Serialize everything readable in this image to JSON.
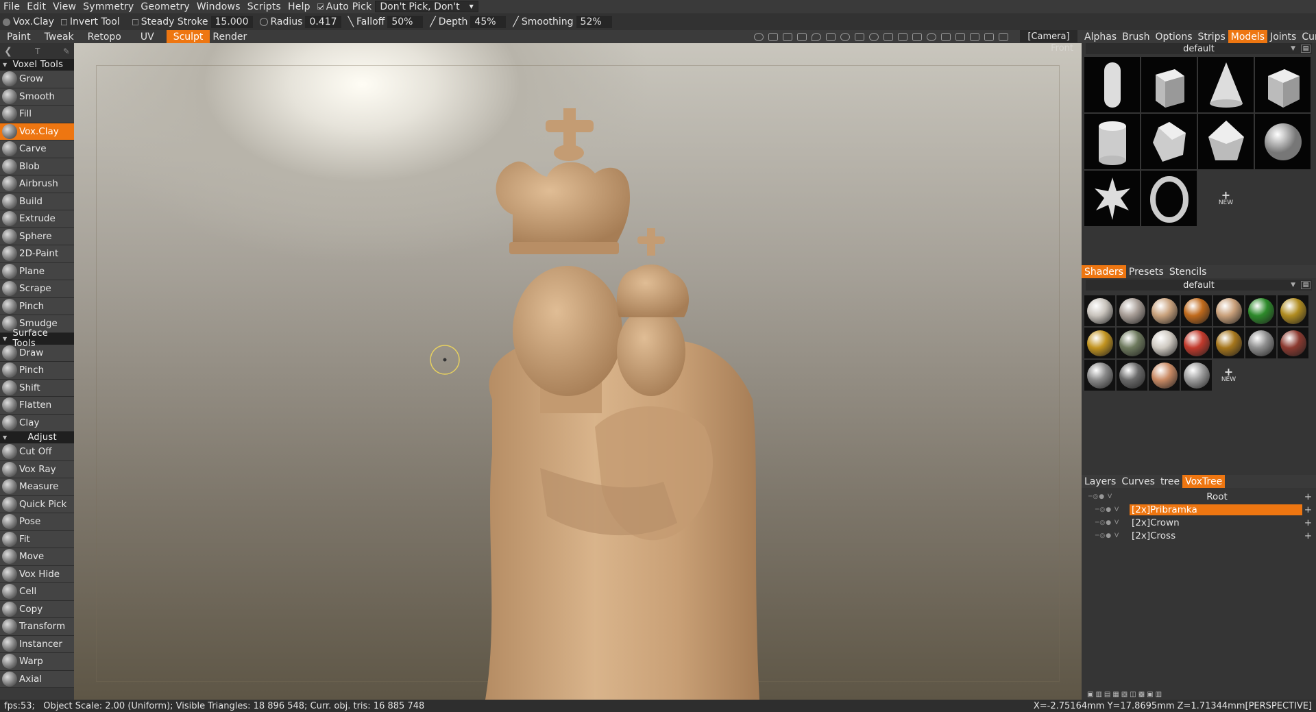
{
  "menubar": {
    "items": [
      "File",
      "Edit",
      "View",
      "Symmetry",
      "Geometry",
      "Windows",
      "Scripts",
      "Help"
    ],
    "auto_pick": "Auto Pick",
    "pick_mode": "Don't Pick, Don't"
  },
  "toolbar": {
    "tool_name": "Vox.Clay",
    "invert": "Invert Tool",
    "steady_stroke_label": "Steady Stroke",
    "steady_stroke_value": "15.000",
    "radius_label": "Radius",
    "radius_value": "0.417",
    "falloff_label": "Falloff",
    "falloff_value": "50%",
    "depth_label": "Depth",
    "depth_value": "45%",
    "smoothing_label": "Smoothing",
    "smoothing_value": "52%"
  },
  "rooms": {
    "items": [
      "Paint",
      "Tweak",
      "Retopo",
      "UV",
      "Sculpt",
      "Render"
    ],
    "active": "Sculpt"
  },
  "viewport": {
    "camera": "[Camera]",
    "view_label": "Front"
  },
  "left_panel": {
    "voxel_tools_title": "Voxel Tools",
    "voxel_tools": [
      "Grow",
      "Smooth",
      "Fill",
      "Vox.Clay",
      "Carve",
      "Blob",
      "Airbrush",
      "Build",
      "Extrude",
      "Sphere",
      "2D-Paint",
      "Plane",
      "Scrape",
      "Pinch",
      "Smudge"
    ],
    "surface_tools_title": "Surface Tools",
    "surface_tools": [
      "Draw",
      "Pinch",
      "Shift",
      "Flatten",
      "Clay"
    ],
    "adjust_title": "Adjust",
    "adjust_tools": [
      "Cut Off",
      "Vox Ray",
      "Measure",
      "Quick Pick",
      "Pose",
      "Fit",
      "Move",
      "Vox Hide",
      "Cell",
      "Copy",
      "Transform",
      "Instancer",
      "Warp",
      "Axial"
    ],
    "selected_tool": "Vox.Clay"
  },
  "right_panel": {
    "top_tabs": [
      "Alphas",
      "Brush",
      "Options",
      "Strips",
      "Models",
      "Joints",
      "Curves"
    ],
    "top_active": "Models",
    "models_preset": "default",
    "models": [
      "capsule",
      "cube",
      "cone",
      "cube-rounded",
      "cylinder",
      "dodecahedron",
      "icosahedron",
      "sphere",
      "spiky-star",
      "torus"
    ],
    "new_label": "NEW",
    "mid_tabs": [
      "Shaders",
      "Presets",
      "Stencils"
    ],
    "mid_active": "Shaders",
    "shaders_preset": "default",
    "shader_colors": [
      "#c9c4bd",
      "#a79d96",
      "#c9a27d",
      "#c06a1c",
      "#c9a07a",
      "#2d8a2a",
      "#b08c20",
      "#c29420",
      "#6e7a5e",
      "#cfcac2",
      "#c23a2c",
      "#a6761c",
      "#8e8e8e",
      "#8c3a30",
      "#8a8a8a",
      "#6a6a6a",
      "#c98a64",
      "#9c9c9c"
    ],
    "layer_tabs": [
      "Layers",
      "Curves",
      "tree",
      "VoxTree"
    ],
    "layer_active": "VoxTree",
    "tree": {
      "root": "Root",
      "items": [
        "[2x]Pribramka",
        "[2x]Crown",
        "[2x]Cross"
      ],
      "selected": "[2x]Pribramka"
    }
  },
  "statusbar": {
    "left": "fps:53;   Object Scale: 2.00 (Uniform); Visible Triangles: 18 896 548; Curr. obj. tris: 16 885 748",
    "right": "X=-2.75164mm  Y=17.8695mm  Z=1.71344mm[PERSPECTIVE]"
  }
}
